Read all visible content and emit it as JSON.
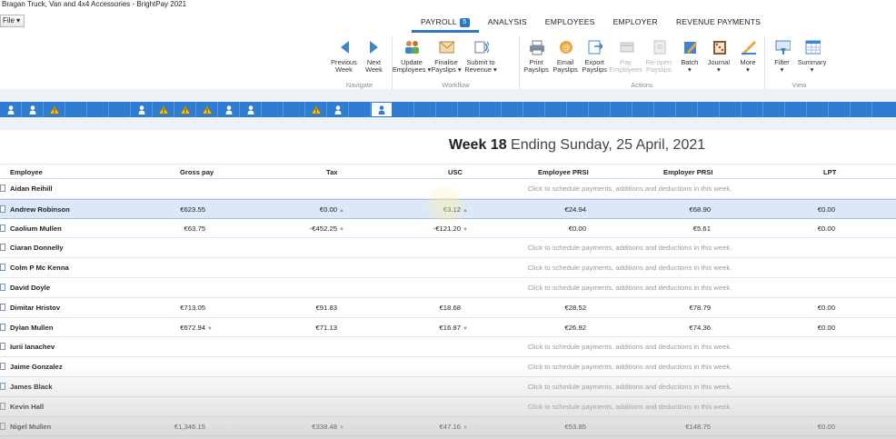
{
  "window": {
    "title": "Bragan Truck, Van and 4x4 Accessories - BrightPay 2021",
    "file_menu": "File ▾"
  },
  "tabs": [
    {
      "label": "PAYROLL",
      "count": "5"
    },
    {
      "label": "ANALYSIS"
    },
    {
      "label": "EMPLOYEES"
    },
    {
      "label": "EMPLOYER"
    },
    {
      "label": "REVENUE PAYMENTS"
    }
  ],
  "ribbon": {
    "navigate": {
      "label": "Navigate",
      "previous": [
        "Previous",
        "Week"
      ],
      "next": [
        "Next",
        "Week"
      ]
    },
    "workflow": {
      "label": "Workflow",
      "update": [
        "Update",
        "Employees ▾"
      ],
      "finalise": [
        "Finalise",
        "Payslips ▾"
      ],
      "submit": [
        "Submit to",
        "Revenue ▾"
      ]
    },
    "actions": {
      "label": "Actions",
      "print": [
        "Print",
        "Payslips"
      ],
      "email": [
        "Email",
        "Payslips"
      ],
      "export": [
        "Export",
        "Payslips"
      ],
      "pay": [
        "Pay",
        "Employees"
      ],
      "reopen": [
        "Re-open",
        "Payslips"
      ],
      "batch": [
        "Batch",
        "▾"
      ],
      "journal": [
        "Journal",
        "▾"
      ],
      "more": [
        "More",
        "▾"
      ]
    },
    "view": {
      "label": "View",
      "filter": [
        "Filter",
        "▾"
      ],
      "summary": [
        "Summary",
        "▾"
      ]
    }
  },
  "strip": [
    "person",
    "person",
    "warning",
    "",
    "",
    "",
    "person",
    "warning",
    "warning",
    "warning",
    "person",
    "person",
    "",
    "",
    "warning",
    "person",
    "",
    "person-selected",
    "",
    "",
    "",
    "",
    "",
    "",
    "",
    "",
    "",
    "",
    "",
    "",
    "",
    "",
    "",
    "",
    "",
    "",
    "",
    "",
    "",
    ""
  ],
  "period": {
    "week": "Week 18",
    "ending": "Ending Sunday, 25 April, 2021"
  },
  "table": {
    "headers": {
      "employee": "Employee",
      "gross": "Gross pay",
      "tax": "Tax",
      "usc": "USC",
      "eprsi": "Employee PRSI",
      "rprsi": "Employer PRSI",
      "lpt": "LPT"
    },
    "hint": "Click to schedule payments, additions and deductions in this week.",
    "rows": [
      {
        "name": "Aidan Reihill"
      },
      {
        "name": "Andrew Robinson",
        "gross": "€623.55",
        "tax": "€0.00",
        "tax_tri": "▲",
        "usc": "€3.12",
        "usc_tri": "▲",
        "eprsi": "€24.94",
        "rprsi": "€68.90",
        "lpt": "€0.00",
        "selected": true
      },
      {
        "name": "Caolium Mullen",
        "gross": "€63.75",
        "tax": "-€452.25",
        "tax_tri": "▼",
        "usc": "-€121.20",
        "usc_tri": "▼",
        "eprsi": "€0.00",
        "rprsi": "€5.61",
        "lpt": "€0.00"
      },
      {
        "name": "Ciaran  Donnelly"
      },
      {
        "name": "Colm P Mc Kenna"
      },
      {
        "name": "David Doyle"
      },
      {
        "name": "Dimitar Hristov",
        "gross": "€713.05",
        "tax": "€91.83",
        "usc": "€18.68",
        "eprsi": "€28.52",
        "rprsi": "€78.79",
        "lpt": "€0.00"
      },
      {
        "name": "Dylan Mullen",
        "gross": "€672.94",
        "gross_tri": "▼",
        "tax": "€71.13",
        "usc": "€16.87",
        "usc_tri": "▼",
        "eprsi": "€26.92",
        "rprsi": "€74.36",
        "lpt": "€0.00"
      },
      {
        "name": "Iurii Ianachev"
      },
      {
        "name": "Jaime Gonzalez"
      },
      {
        "name": "James Black"
      },
      {
        "name": "Kevin Hall"
      },
      {
        "name": "Nigel Mullen",
        "gross": "€1,346.15",
        "tax": "€338.48",
        "tax_tri": "▼",
        "usc": "€47.16",
        "usc_tri": "▼",
        "eprsi": "€53.85",
        "rprsi": "€148.75",
        "lpt": "€0.00"
      }
    ]
  },
  "colors": {
    "accent": "#2b78c8",
    "strip": "#2f7dd2",
    "selected_row": "#dce8f7",
    "warning": "#f2c21b"
  }
}
